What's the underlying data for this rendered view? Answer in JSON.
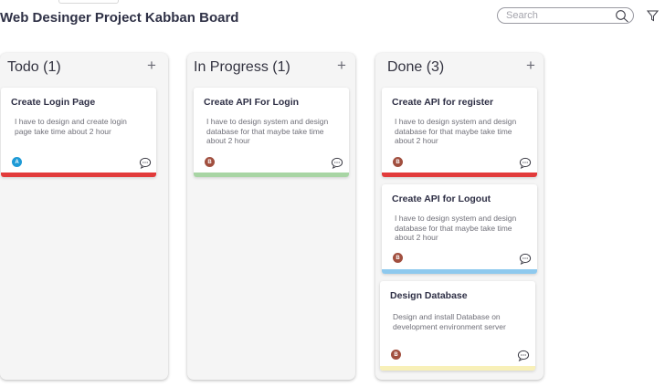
{
  "board": {
    "title": "Web Desinger Project Kabban Board"
  },
  "search": {
    "placeholder": "Search"
  },
  "icons": {
    "search": "search-icon",
    "filter": "filter-icon",
    "add": "plus-icon",
    "comment": "comment-icon"
  },
  "colors": {
    "red": "#e23b3b",
    "green": "#a8d5a4",
    "blue": "#8ec9ee",
    "yellow": "#f8f0b8",
    "avatar_blue": "#1e9ad6",
    "avatar_brown": "#a14f3f"
  },
  "columns": [
    {
      "title": "Todo (1)",
      "add_label": "+",
      "cards": [
        {
          "title": "Create Login Page",
          "description": "I have to design and create login page take time about 2 hour",
          "avatar": "A"
        }
      ]
    },
    {
      "title": "In Progress (1)",
      "add_label": "+",
      "cards": [
        {
          "title": "Create API For Login",
          "description": "I have to design system and design database for that maybe take time about 2 hour",
          "avatar": "B"
        }
      ]
    },
    {
      "title": "Done (3)",
      "add_label": "+",
      "cards": [
        {
          "title": "Create API for register",
          "description": "I have to design system and design database for that maybe take time about 2 hour",
          "avatar": "B"
        },
        {
          "title": "Create API for Logout",
          "description": "I have to design system and design database for that maybe take time about 2 hour",
          "avatar": "B"
        },
        {
          "title": "Design Database",
          "description": "Design and install Database on development environment server",
          "avatar": "B"
        }
      ]
    }
  ]
}
